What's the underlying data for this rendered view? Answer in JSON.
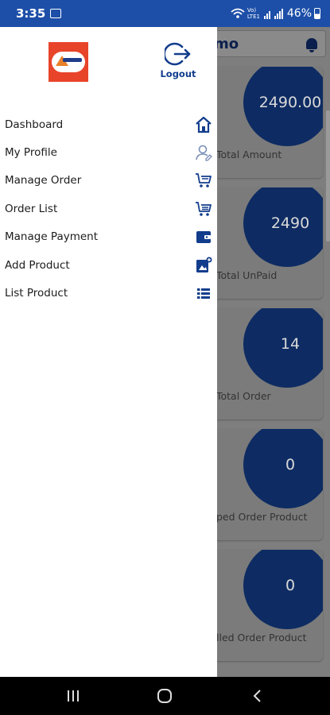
{
  "status_bar": {
    "time": "3:35",
    "network": "Vo) LTE1",
    "battery": "46%"
  },
  "background": {
    "title": "mo",
    "cards": [
      {
        "value": "2490.00",
        "label": "Total Amount"
      },
      {
        "value": "2490",
        "label": "Total UnPaid"
      },
      {
        "value": "14",
        "label": "Total Order"
      },
      {
        "value": "0",
        "label": "ped Order Product"
      },
      {
        "value": "0",
        "label": "lled Order Product"
      }
    ]
  },
  "drawer": {
    "logout_label": "Logout",
    "items": [
      {
        "label": "Dashboard",
        "icon": "home-icon"
      },
      {
        "label": "My Profile",
        "icon": "profile-icon"
      },
      {
        "label": "Manage Order",
        "icon": "cart-icon"
      },
      {
        "label": "Order List",
        "icon": "cart-list-icon"
      },
      {
        "label": "Manage Payment",
        "icon": "wallet-icon"
      },
      {
        "label": "Add Product",
        "icon": "add-product-icon"
      },
      {
        "label": "List Product",
        "icon": "list-icon"
      }
    ]
  },
  "colors": {
    "status_bar": "#1d4fa8",
    "accent": "#123d8c",
    "card_circle": "#0e2c63",
    "logo_bg": "#e8442a"
  }
}
